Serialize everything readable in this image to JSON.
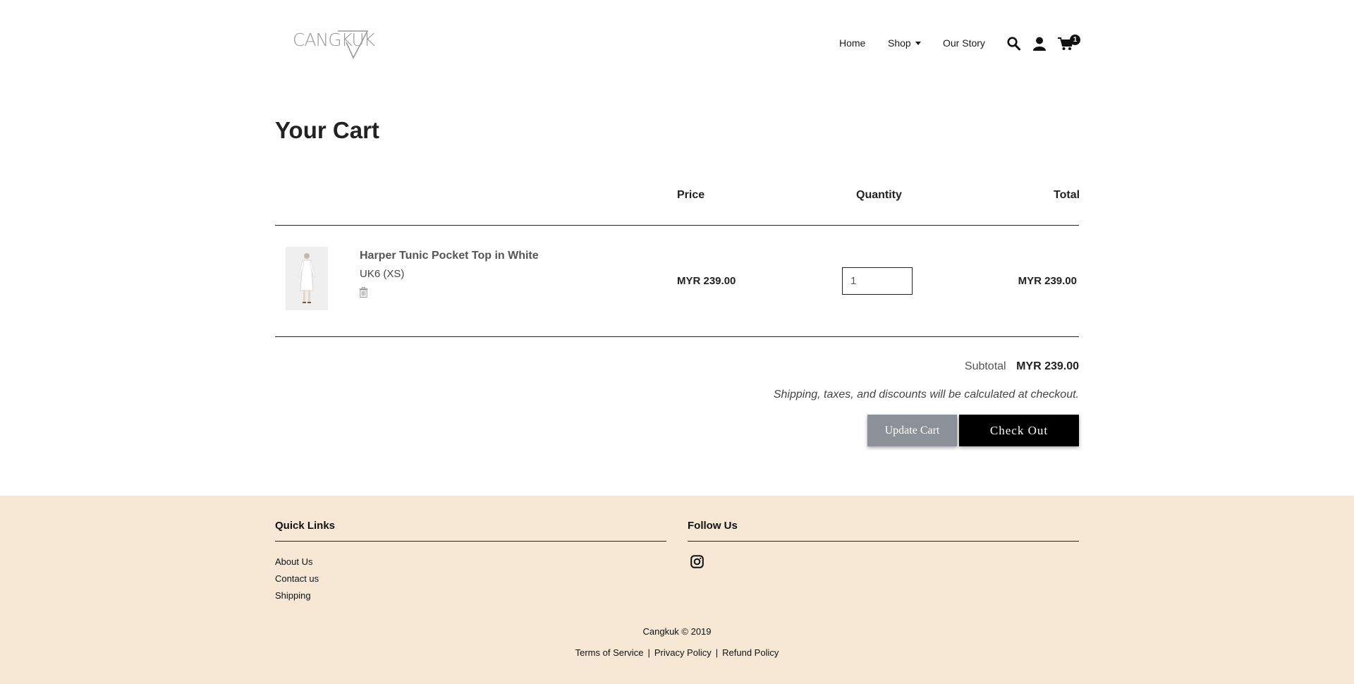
{
  "header": {
    "logo_text": "CANGKUK",
    "nav": {
      "home": "Home",
      "shop": "Shop",
      "our_story": "Our Story"
    },
    "icons": [
      "search-icon",
      "account-icon",
      "cart-icon"
    ],
    "cart_count": "1"
  },
  "cart": {
    "title": "Your Cart",
    "columns": {
      "price": "Price",
      "quantity": "Quantity",
      "total": "Total"
    },
    "items": [
      {
        "name": "Harper Tunic Pocket Top in White",
        "variant": "UK6 (XS)",
        "price": "MYR 239.00",
        "quantity": "1",
        "total": "MYR 239.00"
      }
    ],
    "subtotal_label": "Subtotal",
    "subtotal_value": "MYR 239.00",
    "note": "Shipping, taxes, and discounts will be calculated at checkout.",
    "update_button": "Update Cart",
    "checkout_button": "Check Out"
  },
  "footer": {
    "quick_links_heading": "Quick Links",
    "quick_links": [
      "About Us",
      "Contact us",
      "Shipping"
    ],
    "follow_heading": "Follow Us",
    "copyright": "Cangkuk © 2019",
    "legal": {
      "terms": "Terms of Service",
      "privacy": "Privacy Policy",
      "refund": "Refund Policy",
      "separator": "|"
    }
  },
  "colors": {
    "footer_bg": "#f7e8d5",
    "update_button_bg": "#8c9098",
    "checkout_button_bg": "#000000"
  }
}
